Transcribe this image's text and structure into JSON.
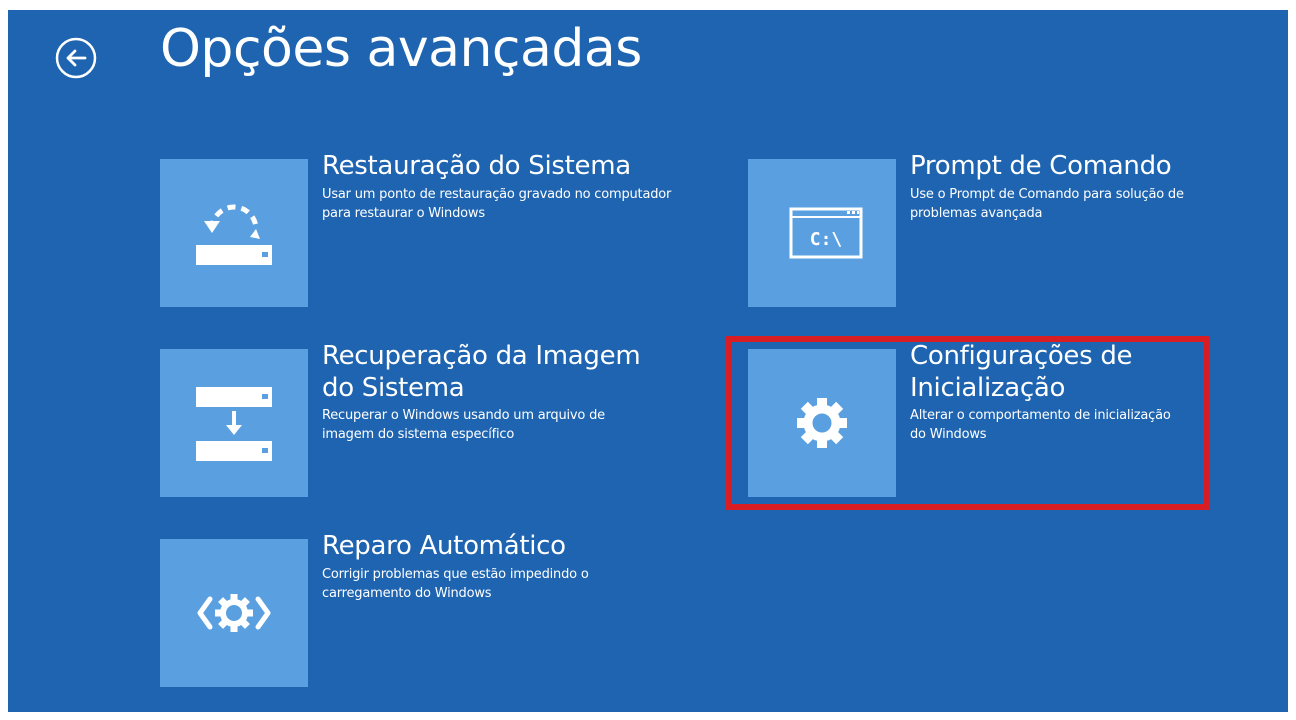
{
  "header": {
    "title": "Opções avançadas",
    "back_icon": "back-arrow-icon"
  },
  "options": [
    {
      "title": "Restauração do Sistema",
      "description": "Usar um ponto de restauração gravado no computador para restaurar o Windows",
      "icon": "system-restore-icon"
    },
    {
      "title": "Recuperação da Imagem do Sistema",
      "description": "Recuperar o Windows usando um arquivo de imagem do sistema específico",
      "icon": "system-image-recovery-icon"
    },
    {
      "title": "Reparo Automático",
      "description": "Corrigir problemas que estão impedindo o carregamento do Windows",
      "icon": "startup-repair-icon"
    },
    {
      "title": "Prompt de Comando",
      "description": "Use o Prompt de Comando para solução de problemas avançada",
      "icon": "command-prompt-icon",
      "icon_text": "C:\\"
    },
    {
      "title": "Configurações de Inicialização",
      "description": "Alterar o comportamento de inicialização do Windows",
      "icon": "gear-icon",
      "highlighted": true
    }
  ],
  "colors": {
    "background": "#1e64b0",
    "tile": "#5aa0e0",
    "text": "#ffffff",
    "highlight": "#d81e22"
  }
}
